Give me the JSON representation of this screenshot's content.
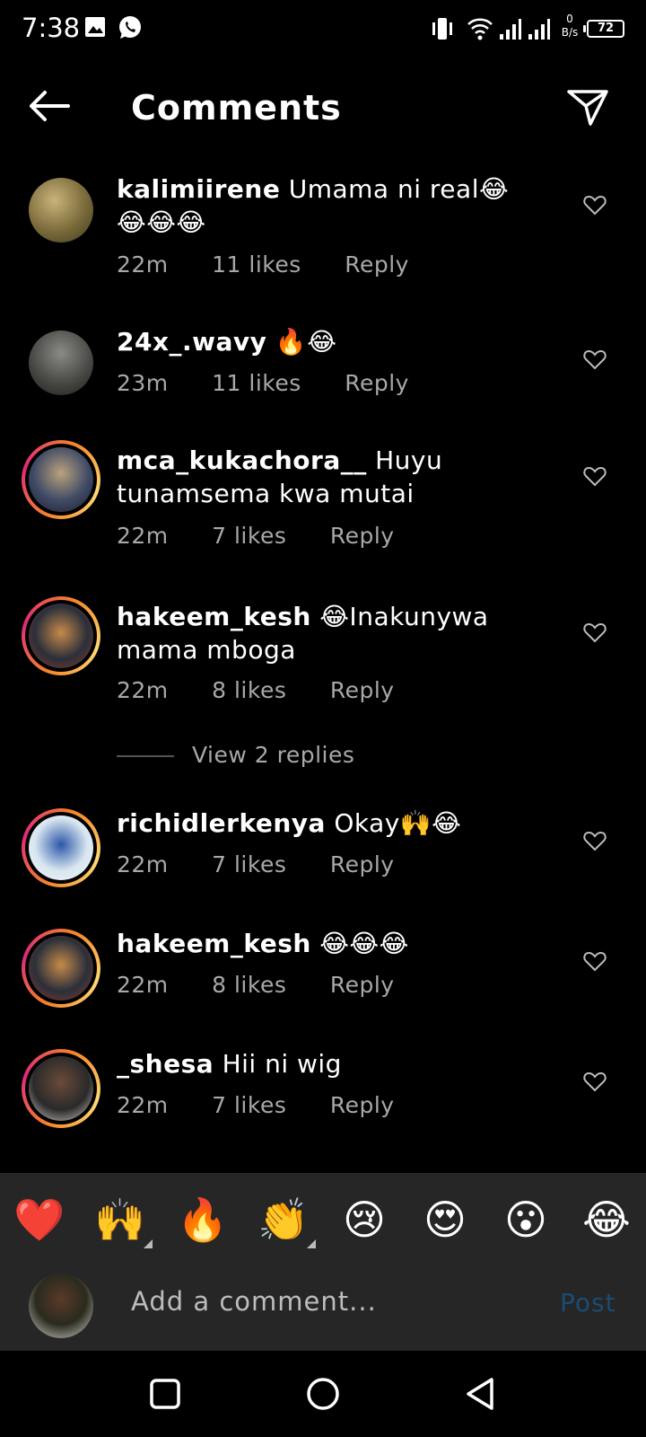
{
  "status_bar": {
    "time": "7:38",
    "net_speed_value": "0",
    "net_speed_unit": "B/s",
    "battery": "72",
    "icons": [
      "gallery-icon",
      "whatsapp-icon",
      "vibrate-icon",
      "wifi-icon",
      "signal-icon",
      "signal-icon"
    ]
  },
  "header": {
    "title": "Comments",
    "back_icon": "arrow-left-icon",
    "send_icon": "paper-plane-icon"
  },
  "comments": [
    {
      "username": "kalimiirene",
      "text": "Umama ni real😂😂😂😂",
      "time": "22m",
      "likes": "11 likes",
      "reply": "Reply",
      "story_ring": false
    },
    {
      "username": "24x_.wavy",
      "text": "🔥😂",
      "time": "23m",
      "likes": "11 likes",
      "reply": "Reply",
      "story_ring": false
    },
    {
      "username": "mca_kukachora__",
      "text": "Huyu tunamsema kwa mutai",
      "time": "22m",
      "likes": "7 likes",
      "reply": "Reply",
      "story_ring": true
    },
    {
      "username": "hakeem_kesh",
      "text": "😂Inakunywa mama mboga",
      "time": "22m",
      "likes": "8 likes",
      "reply": "Reply",
      "story_ring": true,
      "view_replies": "View 2 replies"
    },
    {
      "username": "richidlerkenya",
      "text": "Okay🙌😂",
      "time": "22m",
      "likes": "7 likes",
      "reply": "Reply",
      "story_ring": true
    },
    {
      "username": "hakeem_kesh",
      "text": "😂😂😂",
      "time": "22m",
      "likes": "8 likes",
      "reply": "Reply",
      "story_ring": true
    },
    {
      "username": "_shesa",
      "text": "Hii ni wig",
      "time": "22m",
      "likes": "7 likes",
      "reply": "Reply",
      "story_ring": true
    }
  ],
  "emoji_bar": [
    "❤️",
    "🙌",
    "🔥",
    "👏",
    "😢",
    "😍",
    "😮",
    "😂"
  ],
  "composer": {
    "placeholder": "Add a comment...",
    "post_label": "Post"
  },
  "nav_bar": {
    "icons": [
      "recents-square-icon",
      "home-circle-icon",
      "back-triangle-icon"
    ]
  },
  "colors": {
    "background": "#000000",
    "muted_text": "#a8a8a8",
    "bar_background": "#262626",
    "post_disabled": "#1c4c74"
  }
}
